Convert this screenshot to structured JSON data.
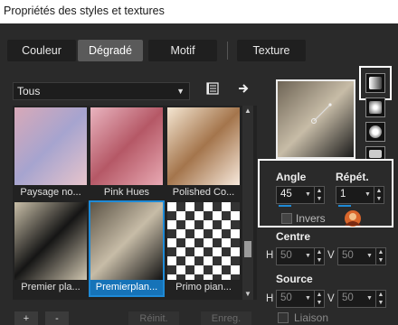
{
  "window": {
    "title": "Propriétés des styles et textures"
  },
  "tabs": [
    {
      "label": "Couleur",
      "active": false
    },
    {
      "label": "Dégradé",
      "active": true
    },
    {
      "label": "Motif",
      "active": false
    },
    {
      "label": "Texture",
      "active": false
    }
  ],
  "category_dropdown": {
    "value": "Tous"
  },
  "toolbar_icons": [
    "gradient-list-icon",
    "arrow-right-icon"
  ],
  "gradients": [
    {
      "label": "Paysage no...",
      "colors": [
        "#d8a9b8",
        "#a6a4cf",
        "#e7c4cb"
      ]
    },
    {
      "label": "Pink Hues",
      "colors": [
        "#e9b4bf",
        "#b55866",
        "#e8a9b3"
      ]
    },
    {
      "label": "Polished Co...",
      "colors": [
        "#f4e6d2",
        "#a4754c",
        "#f7e9dc"
      ]
    },
    {
      "label": "Premier pla...",
      "colors": [
        "#c9bfa8",
        "#151515",
        "#cfc5af"
      ]
    },
    {
      "label": "Premierplan...",
      "colors": [
        "#5c5446",
        "#c7bca7",
        "#121212"
      ],
      "selected": true
    },
    {
      "label": "Primo pian...",
      "colors": [
        "#ffffff",
        "#333333",
        "#ffffff"
      ]
    }
  ],
  "bottom_buttons": {
    "add": "+",
    "remove": "-",
    "reset": "Réinit.",
    "save": "Enreg."
  },
  "styles": [
    "linear",
    "rectangular",
    "sunburst",
    "radial"
  ],
  "angle": {
    "label": "Angle",
    "value": "45"
  },
  "repeat": {
    "label": "Répét.",
    "value": "1"
  },
  "invert": {
    "label": "Invers",
    "checked": false
  },
  "centre": {
    "label": "Centre",
    "h_label": "H",
    "h": "50",
    "v_label": "V",
    "v": "50"
  },
  "source": {
    "label": "Source",
    "h_label": "H",
    "h": "50",
    "v_label": "V",
    "v": "50"
  },
  "link": {
    "label": "Liaison",
    "checked": false
  },
  "colors": {
    "accent": "#1e8ad6",
    "highlight": "#ffffff"
  }
}
